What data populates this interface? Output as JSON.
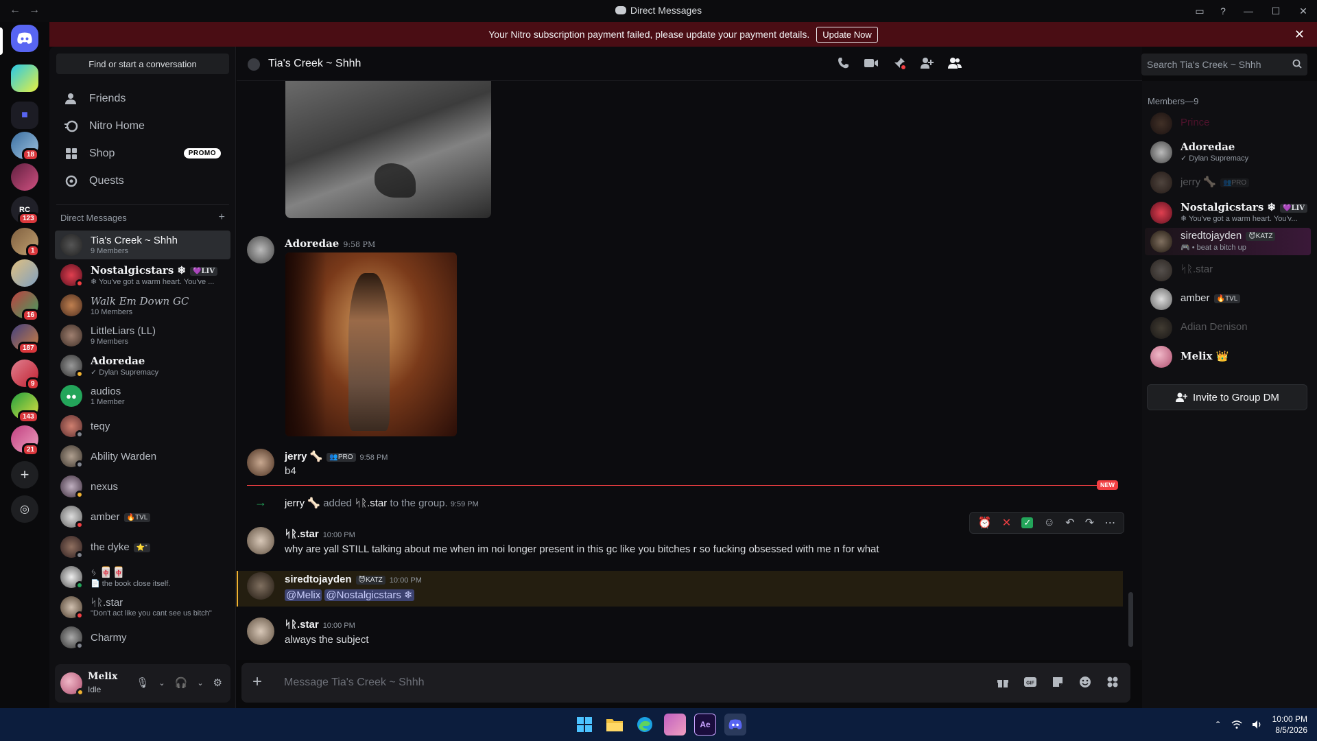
{
  "window": {
    "title": "Direct Messages"
  },
  "banner": {
    "text": "Your Nitro subscription payment failed, please update your payment details.",
    "button": "Update Now"
  },
  "rail": {
    "badges": [
      "18",
      "123",
      "1",
      "16",
      "187",
      "9",
      "143",
      "21"
    ]
  },
  "sidebar": {
    "search": "Find or start a conversation",
    "nav": [
      {
        "label": "Friends",
        "icon": "friends-icon"
      },
      {
        "label": "Nitro Home",
        "icon": "nitro-icon"
      },
      {
        "label": "Shop",
        "icon": "shop-icon",
        "badge": "PROMO"
      },
      {
        "label": "Quests",
        "icon": "quests-icon"
      }
    ],
    "dm_header": "Direct Messages",
    "dms": [
      {
        "name": "Tia's Creek ~ Shhh",
        "sub": "9 Members"
      },
      {
        "name": "Nostalgicstars ❄",
        "tag": "💜LIV",
        "sub": "❄ You've got a warm heart. You've ..."
      },
      {
        "name": "Walk Em Down GC",
        "sub": "10 Members"
      },
      {
        "name": "LittleLiars (LL)",
        "sub": "9 Members"
      },
      {
        "name": "Adoredae",
        "sub": "✓ Dylan Supremacy"
      },
      {
        "name": "audios",
        "sub": "1 Member"
      },
      {
        "name": "teqy",
        "sub": ""
      },
      {
        "name": "Ability Warden",
        "sub": ""
      },
      {
        "name": "nexus",
        "sub": ""
      },
      {
        "name": "amber",
        "tag": "🔥TVL",
        "sub": ""
      },
      {
        "name": "the dyke",
        "tag": "⭐\"",
        "sub": ""
      },
      {
        "name": "ᛃ 🀄🀄",
        "sub": "📄 the book close itself."
      },
      {
        "name": "ᛋᚱ.star",
        "sub": "\"Don't act like you cant see us bitch\""
      },
      {
        "name": "Charmy",
        "sub": ""
      }
    ]
  },
  "user": {
    "name": "Melix",
    "status": "Idle"
  },
  "chat": {
    "title": "Tia's Creek ~ Shhh",
    "search_placeholder": "Search Tia's Creek ~ Shhh",
    "composer_placeholder": "Message Tia's Creek ~ Shhh",
    "new_label": "NEW",
    "messages": [
      {
        "author": "Adoredae",
        "time": "9:58 PM"
      },
      {
        "author": "jerry 🦴",
        "tag": "👥PRO",
        "time": "9:58 PM",
        "text": "b4"
      },
      {
        "system_author": "jerry 🦴",
        "system_action": "added",
        "system_target": "ᛋᚱ.star",
        "system_rest": "to the group.",
        "time": "9:59 PM"
      },
      {
        "author": "ᛋᚱ.star",
        "time": "10:00 PM",
        "text": "why are yall STILL talking about me when im noi longer present in this gc like you bitches r so fucking obsessed with me n for what"
      },
      {
        "author": "siredtojayden",
        "tag": "😈KATZ",
        "time": "10:00 PM",
        "mention1": "@Melix",
        "mention2": "@Nostalgicstars ❄"
      },
      {
        "author": "ᛋᚱ.star",
        "time": "10:00 PM",
        "text": "always the subject"
      }
    ]
  },
  "members": {
    "header": "Members—9",
    "list": [
      {
        "name": "Prince",
        "color": "#c2185b",
        "offline": true
      },
      {
        "name": "Adoredae",
        "sub": "✓ Dylan Supremacy",
        "color": "#f2f3f5"
      },
      {
        "name": "jerry 🦴",
        "tag": "👥PRO",
        "color": "#f2f3f5",
        "offline": true
      },
      {
        "name": "Nostalgicstars ❄",
        "tag": "💜LIV",
        "sub": "❄ You've got a warm heart. You'v...",
        "color": "#f2f3f5"
      },
      {
        "name": "siredtojayden",
        "tag": "😈KATZ",
        "sub": "🎮 • beat a bitch up",
        "color": "#dbdee1"
      },
      {
        "name": "ᛋᚱ.star",
        "color": "#dbdee1",
        "offline": true
      },
      {
        "name": "amber",
        "tag": "🔥TVL",
        "color": "#dbdee1"
      },
      {
        "name": "Adian Denison",
        "color": "#dbdee1",
        "offline": true
      },
      {
        "name": "Melix 👑",
        "color": "#f2f3f5"
      }
    ],
    "invite": "Invite to Group DM"
  },
  "taskbar": {
    "time": "10:00 PM",
    "date": "8/5/2026"
  }
}
